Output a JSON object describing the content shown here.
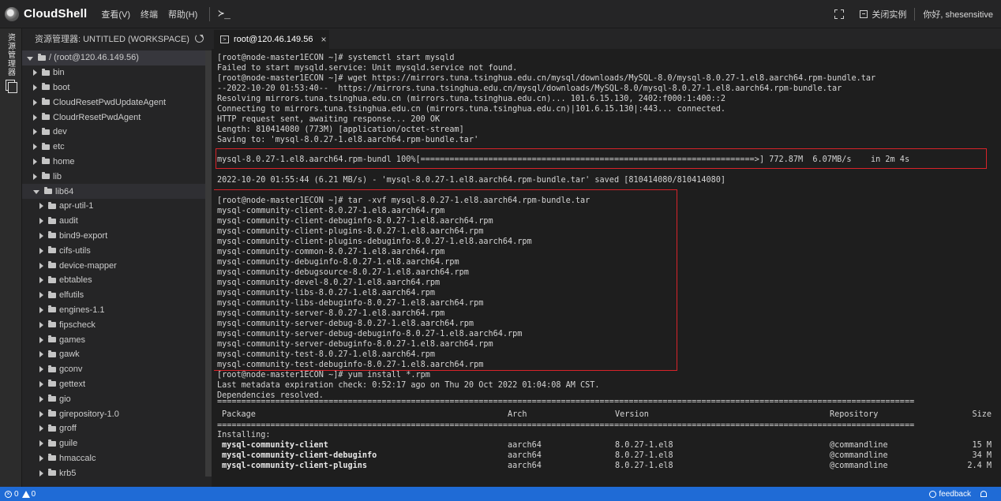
{
  "brand": {
    "name": "CloudShell"
  },
  "menu": [
    "查看(V)",
    "终端",
    "帮助(H)"
  ],
  "topbar": {
    "terminal_glyph": "≻_",
    "close_instance": "关闭实例",
    "greeting": "你好, shesensitive"
  },
  "activity": {
    "explorer_label": "资源管理器"
  },
  "sidebar": {
    "title": "资源管理器: UNTITLED (WORKSPACE)",
    "items": [
      {
        "label": "/ (root@120.46.149.56)",
        "level": 0,
        "expanded": true
      },
      {
        "label": "bin",
        "level": 1,
        "expanded": false
      },
      {
        "label": "boot",
        "level": 1,
        "expanded": false
      },
      {
        "label": "CloudResetPwdUpdateAgent",
        "level": 1,
        "expanded": false
      },
      {
        "label": "CloudrResetPwdAgent",
        "level": 1,
        "expanded": false
      },
      {
        "label": "dev",
        "level": 1,
        "expanded": false
      },
      {
        "label": "etc",
        "level": 1,
        "expanded": false
      },
      {
        "label": "home",
        "level": 1,
        "expanded": false
      },
      {
        "label": "lib",
        "level": 1,
        "expanded": false
      },
      {
        "label": "lib64",
        "level": 1,
        "expanded": true
      },
      {
        "label": "apr-util-1",
        "level": 2,
        "expanded": false
      },
      {
        "label": "audit",
        "level": 2,
        "expanded": false
      },
      {
        "label": "bind9-export",
        "level": 2,
        "expanded": false
      },
      {
        "label": "cifs-utils",
        "level": 2,
        "expanded": false
      },
      {
        "label": "device-mapper",
        "level": 2,
        "expanded": false
      },
      {
        "label": "ebtables",
        "level": 2,
        "expanded": false
      },
      {
        "label": "elfutils",
        "level": 2,
        "expanded": false
      },
      {
        "label": "engines-1.1",
        "level": 2,
        "expanded": false
      },
      {
        "label": "fipscheck",
        "level": 2,
        "expanded": false
      },
      {
        "label": "games",
        "level": 2,
        "expanded": false
      },
      {
        "label": "gawk",
        "level": 2,
        "expanded": false
      },
      {
        "label": "gconv",
        "level": 2,
        "expanded": false
      },
      {
        "label": "gettext",
        "level": 2,
        "expanded": false
      },
      {
        "label": "gio",
        "level": 2,
        "expanded": false
      },
      {
        "label": "girepository-1.0",
        "level": 2,
        "expanded": false
      },
      {
        "label": "groff",
        "level": 2,
        "expanded": false
      },
      {
        "label": "guile",
        "level": 2,
        "expanded": false
      },
      {
        "label": "hmaccalc",
        "level": 2,
        "expanded": false
      },
      {
        "label": "krb5",
        "level": 2,
        "expanded": false
      }
    ]
  },
  "tab": {
    "label": "root@120.46.149.56",
    "close": "×"
  },
  "terminal": {
    "lines_top": [
      "[root@node-master1ECON ~]# systemctl start mysqld",
      "Failed to start mysqld.service: Unit mysqld.service not found.",
      "[root@node-master1ECON ~]# wget https://mirrors.tuna.tsinghua.edu.cn/mysql/downloads/MySQL-8.0/mysql-8.0.27-1.el8.aarch64.rpm-bundle.tar",
      "--2022-10-20 01:53:40--  https://mirrors.tuna.tsinghua.edu.cn/mysql/downloads/MySQL-8.0/mysql-8.0.27-1.el8.aarch64.rpm-bundle.tar",
      "Resolving mirrors.tuna.tsinghua.edu.cn (mirrors.tuna.tsinghua.edu.cn)... 101.6.15.130, 2402:f000:1:400::2",
      "Connecting to mirrors.tuna.tsinghua.edu.cn (mirrors.tuna.tsinghua.edu.cn)|101.6.15.130|:443... connected.",
      "HTTP request sent, awaiting response... 200 OK",
      "Length: 810414080 (773M) [application/octet-stream]",
      "Saving to: 'mysql-8.0.27-1.el8.aarch64.rpm-bundle.tar'"
    ],
    "progress": "mysql-8.0.27-1.el8.aarch64.rpm-bundl 100%[=====================================================================>] 772.87M  6.07MB/s    in 2m 4s",
    "saved": "2022-10-20 01:55:44 (6.21 MB/s) - 'mysql-8.0.27-1.el8.aarch64.rpm-bundle.tar' saved [810414080/810414080]",
    "tar_block": [
      "[root@node-master1ECON ~]# tar -xvf mysql-8.0.27-1.el8.aarch64.rpm-bundle.tar",
      "mysql-community-client-8.0.27-1.el8.aarch64.rpm",
      "mysql-community-client-debuginfo-8.0.27-1.el8.aarch64.rpm",
      "mysql-community-client-plugins-8.0.27-1.el8.aarch64.rpm",
      "mysql-community-client-plugins-debuginfo-8.0.27-1.el8.aarch64.rpm",
      "mysql-community-common-8.0.27-1.el8.aarch64.rpm",
      "mysql-community-debuginfo-8.0.27-1.el8.aarch64.rpm",
      "mysql-community-debugsource-8.0.27-1.el8.aarch64.rpm",
      "mysql-community-devel-8.0.27-1.el8.aarch64.rpm",
      "mysql-community-libs-8.0.27-1.el8.aarch64.rpm",
      "mysql-community-libs-debuginfo-8.0.27-1.el8.aarch64.rpm",
      "mysql-community-server-8.0.27-1.el8.aarch64.rpm",
      "mysql-community-server-debug-8.0.27-1.el8.aarch64.rpm",
      "mysql-community-server-debug-debuginfo-8.0.27-1.el8.aarch64.rpm",
      "mysql-community-server-debuginfo-8.0.27-1.el8.aarch64.rpm",
      "mysql-community-test-8.0.27-1.el8.aarch64.rpm",
      "mysql-community-test-debuginfo-8.0.27-1.el8.aarch64.rpm"
    ],
    "yum_lines": [
      "[root@node-master1ECON ~]# yum install *.rpm",
      "Last metadata expiration check: 0:52:17 ago on Thu 20 Oct 2022 01:04:08 AM CST.",
      "Dependencies resolved."
    ],
    "separator": "================================================================================================================================================",
    "table_header": {
      "package": "Package",
      "arch": "Arch",
      "version": "Version",
      "repository": "Repository",
      "size": "Size"
    },
    "installing": "Installing:",
    "packages": [
      {
        "name": "mysql-community-client",
        "arch": "aarch64",
        "version": "8.0.27-1.el8",
        "repo": "@commandline",
        "size": "15 M"
      },
      {
        "name": "mysql-community-client-debuginfo",
        "arch": "aarch64",
        "version": "8.0.27-1.el8",
        "repo": "@commandline",
        "size": "34 M"
      },
      {
        "name": "mysql-community-client-plugins",
        "arch": "aarch64",
        "version": "8.0.27-1.el8",
        "repo": "@commandline",
        "size": "2.4 M"
      }
    ]
  },
  "statusbar": {
    "errors": "0",
    "warnings": "0",
    "feedback": "feedback"
  },
  "colors": {
    "accent": "#1f6bd6",
    "highlight": "#d8232a",
    "bg": "#1e1e1e"
  }
}
